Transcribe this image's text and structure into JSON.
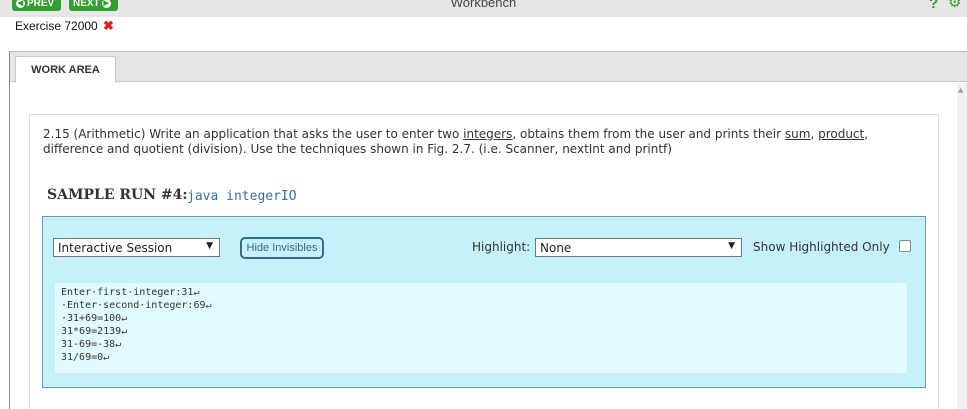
{
  "window": {
    "title": "Workbench",
    "prev_label": "PREV",
    "next_label": "NEXT",
    "help_symbol": "?"
  },
  "exercise": {
    "label": "Exercise 72000",
    "remove_symbol": "✖"
  },
  "tabs": [
    {
      "label": "WORK AREA",
      "selected": true
    }
  ],
  "problem": {
    "prefix": "2.15 (Arithmetic) Write an application that asks the user to enter two ",
    "link_integers": "integers",
    "mid1": ", obtains them from the user and prints their ",
    "link_sum": "sum",
    "sep": ", ",
    "link_product": "product",
    "suffix": ", difference and quotient (division). Use the techniques shown in Fig. 2.7. (i.e. Scanner, nextInt and printf)"
  },
  "sample_run": {
    "label": "SAMPLE RUN #4:",
    "command": "java integerIO"
  },
  "session": {
    "mode_selected": "Interactive Session",
    "hide_invisibles_label": "Hide Invisibles",
    "highlight_label": "Highlight:",
    "highlight_selected": "None",
    "show_highlighted_label": "Show Highlighted Only",
    "show_highlighted_checked": false
  },
  "output": {
    "lines": [
      "Enter·first·integer:31↵",
      "·Enter·second·integer:69↵",
      "·31+69=100↵",
      "31*69=2139↵",
      "31-69=-38↵",
      "31/69=0↵"
    ]
  },
  "colors": {
    "nav_green": "#2ea12e",
    "panel_bg": "#c5f1fb",
    "remove_red": "#e02020"
  }
}
